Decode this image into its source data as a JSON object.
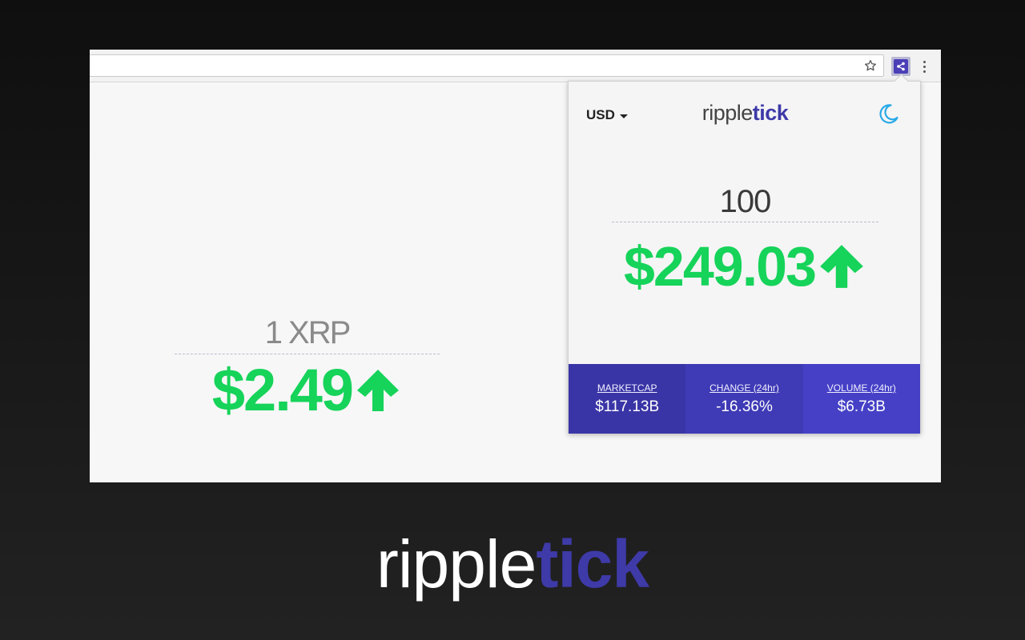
{
  "browser": {
    "toolbar": {
      "bookmark_icon": "star-icon",
      "extension_icon": "ripple-logo-icon",
      "menu_icon": "kebab-menu-icon"
    }
  },
  "page": {
    "amount_label": "1 XRP",
    "price": "$2.49",
    "trend": "up-arrow-icon"
  },
  "popup": {
    "currency": "USD",
    "logo": {
      "light": "ripple",
      "bold": "tick"
    },
    "theme_icon": "moon-icon",
    "amount": "100",
    "price": "$249.03",
    "trend": "up-arrow-icon",
    "stats": [
      {
        "label": "MARKETCAP",
        "value": "$117.13B",
        "color": "#3a35a6"
      },
      {
        "label": "CHANGE (24hr)",
        "value": "-16.36%",
        "color": "#3f3ab5"
      },
      {
        "label": "VOLUME (24hr)",
        "value": "$6.73B",
        "color": "#4540c6"
      }
    ]
  },
  "brand": {
    "light": "ripple",
    "bold": "tick"
  },
  "colors": {
    "price_green": "#16d35a",
    "accent_indigo": "#3e3aa8",
    "moon_blue": "#29a9e8"
  }
}
